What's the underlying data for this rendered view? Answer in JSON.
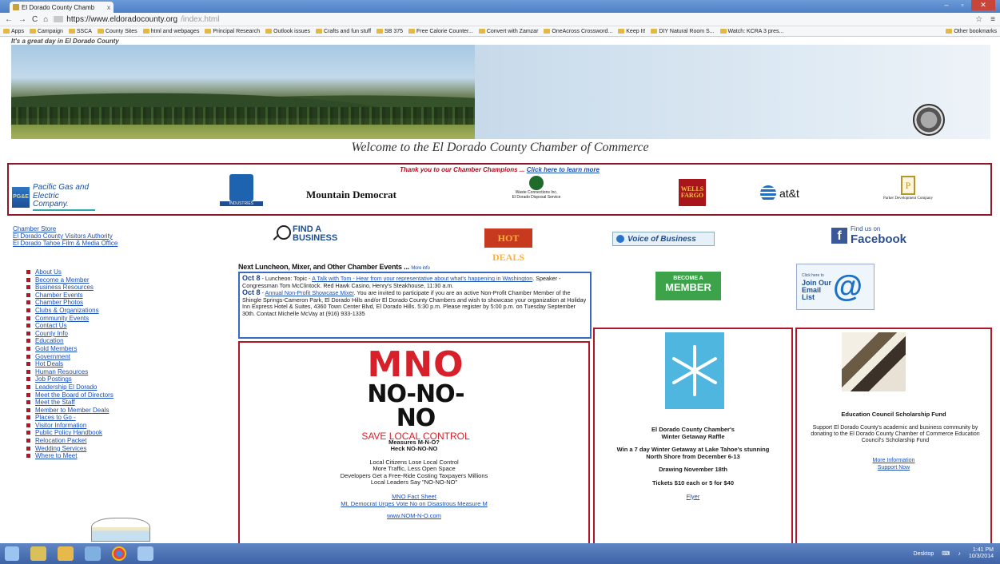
{
  "browser": {
    "tab_title": "El Dorado County Chamb",
    "tab_close": "x",
    "url_host": "https://www.eldoradocounty.org",
    "url_path": "/index.html",
    "bookmarks": [
      "Apps",
      "Campaign",
      "SSCA",
      "County Sites",
      "html and webpages",
      "Principal Research",
      "Outlook issues",
      "Crafts and fun stuff",
      "SB 375",
      "Free Calorie Counter...",
      "Convert with Zamzar",
      "OneAcross Crossword...",
      "Keep It!",
      "DIY Natural Room S...",
      "Watch: KCRA 3 pres..."
    ],
    "other_bookmarks": "Other bookmarks"
  },
  "header": {
    "tagline": "It's a great day in El Dorado County",
    "welcome": "Welcome to the El Dorado County Chamber of Commerce"
  },
  "champions": {
    "title": "Thank you to our Chamber Champions ...",
    "link": "Click here to learn more",
    "pge": "Pacific Gas and Electric Company.",
    "pge_mark": "PG&E",
    "sierra": "INDUSTRIES",
    "mountain_democrat": "Mountain Democrat",
    "waste": "Waste Connections Inc.",
    "waste_sub": "El Dorado Disposal Service",
    "wells_fargo": "WELLS FARGO",
    "att": "at&t",
    "parker": "Parker Development Company",
    "parker_mark": "P"
  },
  "quick_links": [
    "Chamber Store",
    "El Dorado County Visitors Authority",
    "El Dorado Tahoe Film & Media Office"
  ],
  "find_business": [
    "FIND A",
    "BUSINESS"
  ],
  "hot_deals": "HOT DEALS",
  "voice": "Voice of Business",
  "facebook": {
    "find_us": "Find us on",
    "name": "Facebook",
    "mark": "f"
  },
  "sidebar": [
    "About Us",
    "Become a Member",
    "Business Resources",
    "Chamber Events",
    "Chamber Photos",
    "Clubs & Organizations",
    "Community Events",
    "Contact Us",
    "County Info",
    "Education",
    "Gold Members",
    "Government",
    "Hot Deals",
    "Human Resources",
    "Job Postings",
    "Leadership El Dorado",
    "Meet the Board of Directors",
    "Meet the Staff",
    "Member to Member Deals",
    "Places to Go -",
    "Visitor Information",
    "Public Policy Handbook",
    "Relocation Packet",
    "Wedding Services",
    "Where to Meet"
  ],
  "events": {
    "heading": "Next Luncheon, Mixer, and Other Chamber Events ...",
    "more": "More info",
    "e1_date": "Oct 8",
    "e1_text_a": " - Luncheon: Topic - ",
    "e1_link": "A Talk with Tom - Hear from your representative about what's happening in Washington",
    "e1_text_b": ". Speaker - Congressman Tom McClintock. Red Hawk Casino, Henry's Steakhouse, 11:30 a.m.",
    "e2_date": "Oct 8",
    "e2_text_a": " - ",
    "e2_link": "Annual Non-Profit Showcase Mixer",
    "e2_text_b": ". You are invited to participate if you are an active Non-Profit Chamber Member of the Shingle Springs-Cameron Park, El Dorado Hills and/or El Dorado County Chambers and wish to showcase your organization at Holiday Inn Express Hotel & Suites, 4360 Town Center Blvd, El Dorado Hills. 5:30 p.m. Please register by 5:00 p.m. on Tuesday September 30th. Contact Michelle McVay at (916) 933-1335"
  },
  "become_member": {
    "small": "BECOME A",
    "big": "MEMBER"
  },
  "email_list": {
    "small": "Click here to",
    "line1": "Join Our",
    "line2": "Email",
    "line3": "List",
    "at": "@"
  },
  "mno": {
    "title": "MNO",
    "no": "NO-NO-NO",
    "save": "SAVE LOCAL CONTROL",
    "measures": "Measures M-N-O?",
    "heck": "Heck NO-NO-NO",
    "l1": "Local Citizens Lose Local Control",
    "l2": "More Traffic, Less Open Space",
    "l3": "Developers Get a Free-Ride Costing Taxpayers Millions",
    "l4": "Local Leaders Say \"NO-NO-NO\"",
    "link1": "MNO Fact Sheet",
    "link2": "Mt. Democrat Urges Vote No on Disastrous Measure M",
    "link3": "www.NOM-N-O.com"
  },
  "raffle": {
    "title1": "El Dorado County Chamber's",
    "title2": "Winter Getaway Raffle",
    "win1": "Win a 7 day Winter Getaway at Lake Tahoe's stunning",
    "win2": "North Shore from December 6-13",
    "drawing": "Drawing November 18th",
    "tickets": "Tickets $10 each or 5 for $40",
    "flyer": "Flyer"
  },
  "edu": {
    "title": "Education Council Scholarship Fund",
    "text": "Support El Dorado County's academic and business community by donating to the El Dorado County Chamber of Commerce Education Council's Scholarship Fund",
    "link1": "More Information",
    "link2": "Support Now"
  },
  "taskbar": {
    "desktop": "Desktop",
    "time": "1:41 PM",
    "date": "10/3/2014"
  }
}
